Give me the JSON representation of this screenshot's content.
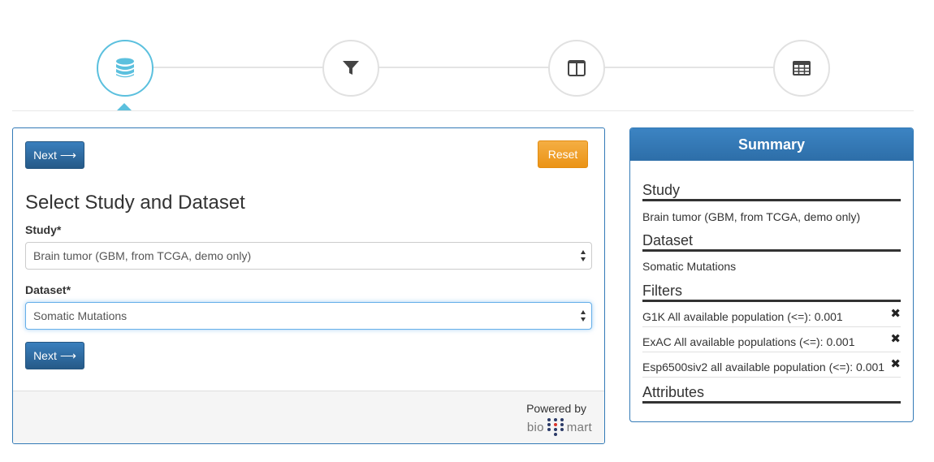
{
  "wizard": {
    "steps": [
      {
        "name": "dataset",
        "icon": "database-icon",
        "active": true
      },
      {
        "name": "filters",
        "icon": "filter-icon",
        "active": false
      },
      {
        "name": "attributes",
        "icon": "columns-icon",
        "active": false
      },
      {
        "name": "results",
        "icon": "table-icon",
        "active": false
      }
    ],
    "active_color": "#5bc0de"
  },
  "main": {
    "next_label": "Next",
    "reset_label": "Reset",
    "title": "Select Study and Dataset",
    "study": {
      "label": "Study*",
      "value": "Brain tumor (GBM, from TCGA, demo only)"
    },
    "dataset": {
      "label": "Dataset*",
      "value": "Somatic Mutations"
    },
    "footer": {
      "powered_by": "Powered by",
      "logo_left": "bio",
      "logo_right": "mart"
    }
  },
  "summary": {
    "title": "Summary",
    "study_heading": "Study",
    "study_value": "Brain tumor (GBM, from TCGA, demo only)",
    "dataset_heading": "Dataset",
    "dataset_value": "Somatic Mutations",
    "filters_heading": "Filters",
    "filters": [
      {
        "text": "G1K All available population (<=): 0.001"
      },
      {
        "text": "ExAC All available populations (<=): 0.001"
      },
      {
        "text": "Esp6500siv2 all available population (<=): 0.001"
      }
    ],
    "attributes_heading": "Attributes",
    "header_color": "#337ab7"
  }
}
